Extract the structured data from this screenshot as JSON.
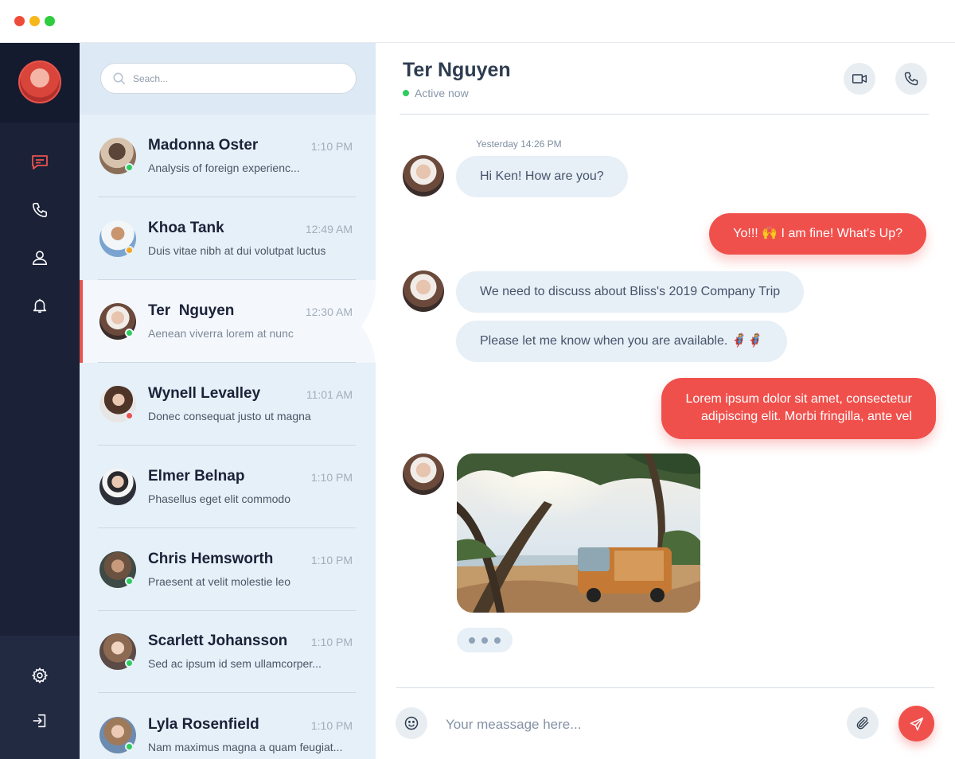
{
  "window": {
    "controls": [
      "close",
      "minimize",
      "maximize"
    ]
  },
  "colors": {
    "accent": "#f0504c",
    "rail": "#1b2238",
    "list_bg": "#e6f0f8",
    "online": "#2ecc5d",
    "away": "#f5a623",
    "busy": "#e9534c",
    "incoming_bubble": "#e7eff7"
  },
  "sidebar": {
    "items": [
      {
        "icon": "chat-icon",
        "active": true
      },
      {
        "icon": "phone-icon",
        "active": false
      },
      {
        "icon": "user-icon",
        "active": false
      },
      {
        "icon": "bell-icon",
        "active": false
      }
    ],
    "bottom": [
      {
        "icon": "gear-icon"
      },
      {
        "icon": "logout-icon"
      }
    ]
  },
  "search": {
    "placeholder": "Seach..."
  },
  "conversations": [
    {
      "name": "Madonna Oster",
      "time": "1:10 PM",
      "preview": "Analysis of foreign experienc...",
      "status": "online",
      "active": false
    },
    {
      "name": "Khoa Tank",
      "time": "12:49 AM",
      "preview": "Duis vitae nibh at dui volutpat luctus",
      "status": "away",
      "active": false
    },
    {
      "name": "Ter  Nguyen",
      "time": "12:30 AM",
      "preview": "Aenean viverra lorem at nunc",
      "status": "online",
      "active": true
    },
    {
      "name": "Wynell Levalley",
      "time": "11:01 AM",
      "preview": "Donec consequat justo ut magna",
      "status": "busy",
      "active": false
    },
    {
      "name": "Elmer Belnap",
      "time": "1:10 PM",
      "preview": "Phasellus eget elit commodo",
      "status": "none",
      "active": false
    },
    {
      "name": "Chris Hemsworth",
      "time": "1:10 PM",
      "preview": "Praesent at velit molestie leo",
      "status": "online",
      "active": false
    },
    {
      "name": "Scarlett Johansson",
      "time": "1:10 PM",
      "preview": "Sed ac ipsum id sem ullamcorper...",
      "status": "online",
      "active": false
    },
    {
      "name": "Lyla Rosenfield",
      "time": "1:10 PM",
      "preview": "Nam maximus magna a quam feugiat...",
      "status": "online",
      "active": false
    }
  ],
  "chat": {
    "contact_name": "Ter Nguyen",
    "status_text": "Active now",
    "header_actions": [
      "video-icon",
      "phone-icon"
    ],
    "timestamp": "Yesterday 14:26 PM",
    "messages": [
      {
        "direction": "in",
        "text": "Hi Ken! How are you?"
      },
      {
        "direction": "out",
        "text": "Yo!!! 🙌 I am fine! What's Up?"
      },
      {
        "direction": "in",
        "text": "We need to discuss about Bliss's 2019 Company Trip"
      },
      {
        "direction": "in",
        "text": "Please let me know when you are available. 🦸🦸"
      },
      {
        "direction": "out",
        "text_line1": "Lorem ipsum dolor sit amet, consectetur",
        "text_line2": "adipiscing elit. Morbi fringilla, ante vel"
      },
      {
        "direction": "in",
        "type": "image",
        "image": "beach-van-photo"
      }
    ],
    "typing_indicator": true
  },
  "composer": {
    "placeholder": "Your meassage here...",
    "value": ""
  }
}
